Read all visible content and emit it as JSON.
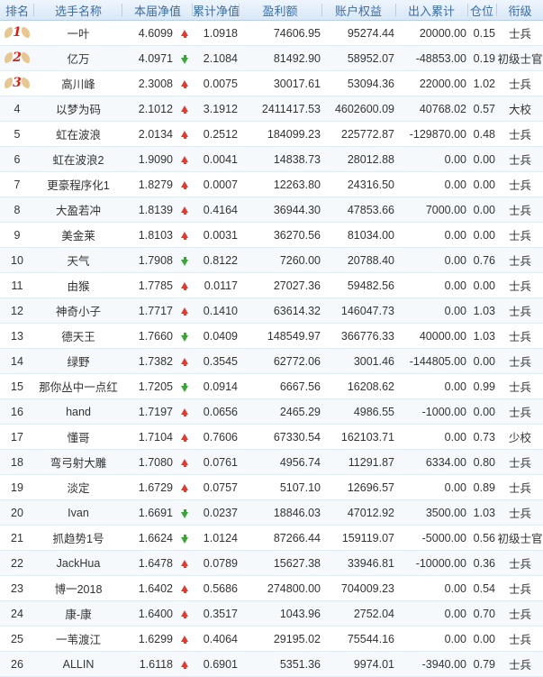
{
  "columns": {
    "rank": "排名",
    "name": "选手名称",
    "nav": "本届净值",
    "cum_nav": "累计净值",
    "profit": "盈利额",
    "equity": "账户权益",
    "flow": "出入累计",
    "position": "仓位",
    "title": "衔级"
  },
  "colors": {
    "up": "#e23b2e",
    "down": "#3aa33a",
    "header_text": "#3a6ea5",
    "medal": "#d2231b"
  },
  "rows": [
    {
      "rank": "1",
      "medal": true,
      "name": "一叶",
      "nav": "4.6099",
      "trend": "up",
      "cum_nav": "1.0918",
      "profit": "74606.95",
      "equity": "95274.44",
      "flow": "20000.00",
      "position": "0.15",
      "title": "士兵"
    },
    {
      "rank": "2",
      "medal": true,
      "name": "亿万",
      "nav": "4.0971",
      "trend": "down",
      "cum_nav": "2.1084",
      "profit": "81492.90",
      "equity": "58952.07",
      "flow": "-48853.00",
      "position": "0.19",
      "title": "初级士官"
    },
    {
      "rank": "3",
      "medal": true,
      "name": "高川峰",
      "nav": "2.3008",
      "trend": "up",
      "cum_nav": "0.0075",
      "profit": "30017.61",
      "equity": "53094.36",
      "flow": "22000.00",
      "position": "1.02",
      "title": "士兵"
    },
    {
      "rank": "4",
      "name": "以梦为码",
      "nav": "2.1012",
      "trend": "up",
      "cum_nav": "3.1912",
      "profit": "2411417.53",
      "equity": "4602600.09",
      "flow": "40768.02",
      "position": "0.57",
      "title": "大校"
    },
    {
      "rank": "5",
      "name": "虹在波浪",
      "nav": "2.0134",
      "trend": "up",
      "cum_nav": "0.2512",
      "profit": "184099.23",
      "equity": "225772.87",
      "flow": "-129870.00",
      "position": "0.48",
      "title": "士兵"
    },
    {
      "rank": "6",
      "name": "虹在波浪2",
      "nav": "1.9090",
      "trend": "up",
      "cum_nav": "0.0041",
      "profit": "14838.73",
      "equity": "28012.88",
      "flow": "0.00",
      "position": "0.00",
      "title": "士兵"
    },
    {
      "rank": "7",
      "name": "更豪程序化1",
      "nav": "1.8279",
      "trend": "up",
      "cum_nav": "0.0007",
      "profit": "12263.80",
      "equity": "24316.50",
      "flow": "0.00",
      "position": "0.00",
      "title": "士兵"
    },
    {
      "rank": "8",
      "name": "大盈若冲",
      "nav": "1.8139",
      "trend": "up",
      "cum_nav": "0.4164",
      "profit": "36944.30",
      "equity": "47853.66",
      "flow": "7000.00",
      "position": "0.00",
      "title": "士兵"
    },
    {
      "rank": "9",
      "name": "美金莱",
      "nav": "1.8103",
      "trend": "up",
      "cum_nav": "0.0031",
      "profit": "36270.56",
      "equity": "81034.00",
      "flow": "0.00",
      "position": "0.00",
      "title": "士兵"
    },
    {
      "rank": "10",
      "name": "天气",
      "nav": "1.7908",
      "trend": "down",
      "cum_nav": "0.8122",
      "profit": "7260.00",
      "equity": "20788.40",
      "flow": "0.00",
      "position": "0.76",
      "title": "士兵"
    },
    {
      "rank": "11",
      "name": "由猴",
      "nav": "1.7785",
      "trend": "up",
      "cum_nav": "0.0117",
      "profit": "27027.36",
      "equity": "59482.56",
      "flow": "0.00",
      "position": "0.00",
      "title": "士兵"
    },
    {
      "rank": "12",
      "name": "神奇小子",
      "nav": "1.7717",
      "trend": "up",
      "cum_nav": "0.1410",
      "profit": "63614.32",
      "equity": "146047.73",
      "flow": "0.00",
      "position": "1.03",
      "title": "士兵"
    },
    {
      "rank": "13",
      "name": "德天王",
      "nav": "1.7660",
      "trend": "down",
      "cum_nav": "0.0409",
      "profit": "148549.97",
      "equity": "366776.33",
      "flow": "40000.00",
      "position": "1.03",
      "title": "士兵"
    },
    {
      "rank": "14",
      "name": "绿野",
      "nav": "1.7382",
      "trend": "up",
      "cum_nav": "0.3545",
      "profit": "62772.06",
      "equity": "3001.46",
      "flow": "-144805.00",
      "position": "0.00",
      "title": "士兵"
    },
    {
      "rank": "15",
      "name": "那你丛中一点红",
      "nav": "1.7205",
      "trend": "down",
      "cum_nav": "0.0914",
      "profit": "6667.56",
      "equity": "16208.62",
      "flow": "0.00",
      "position": "0.99",
      "title": "士兵"
    },
    {
      "rank": "16",
      "name": "hand",
      "nav": "1.7197",
      "trend": "up",
      "cum_nav": "0.0656",
      "profit": "2465.29",
      "equity": "4986.55",
      "flow": "-1000.00",
      "position": "0.00",
      "title": "士兵"
    },
    {
      "rank": "17",
      "name": "懂哥",
      "nav": "1.7104",
      "trend": "up",
      "cum_nav": "0.7606",
      "profit": "67330.54",
      "equity": "162103.71",
      "flow": "0.00",
      "position": "0.73",
      "title": "少校"
    },
    {
      "rank": "18",
      "name": "弯弓射大雕",
      "nav": "1.7080",
      "trend": "up",
      "cum_nav": "0.0761",
      "profit": "4956.74",
      "equity": "11291.87",
      "flow": "6334.00",
      "position": "0.80",
      "title": "士兵"
    },
    {
      "rank": "19",
      "name": "淡定",
      "nav": "1.6729",
      "trend": "up",
      "cum_nav": "0.0757",
      "profit": "5107.10",
      "equity": "12696.57",
      "flow": "0.00",
      "position": "0.89",
      "title": "士兵"
    },
    {
      "rank": "20",
      "name": "Ivan",
      "nav": "1.6691",
      "trend": "down",
      "cum_nav": "0.0237",
      "profit": "18846.03",
      "equity": "47012.92",
      "flow": "3500.00",
      "position": "1.03",
      "title": "士兵"
    },
    {
      "rank": "21",
      "name": "抓趋势1号",
      "nav": "1.6624",
      "trend": "down",
      "cum_nav": "1.0124",
      "profit": "87266.44",
      "equity": "159119.07",
      "flow": "-5000.00",
      "position": "0.56",
      "title": "初级士官"
    },
    {
      "rank": "22",
      "name": "JackHua",
      "nav": "1.6478",
      "trend": "up",
      "cum_nav": "0.0789",
      "profit": "15627.38",
      "equity": "33946.81",
      "flow": "-10000.00",
      "position": "0.36",
      "title": "士兵"
    },
    {
      "rank": "23",
      "name": "博一2018",
      "nav": "1.6402",
      "trend": "up",
      "cum_nav": "0.5686",
      "profit": "274800.00",
      "equity": "704009.23",
      "flow": "0.00",
      "position": "0.54",
      "title": "士兵"
    },
    {
      "rank": "24",
      "name": "康-康",
      "nav": "1.6400",
      "trend": "up",
      "cum_nav": "0.3517",
      "profit": "1043.96",
      "equity": "2752.04",
      "flow": "0.00",
      "position": "0.70",
      "title": "士兵"
    },
    {
      "rank": "25",
      "name": "一苇渡江",
      "nav": "1.6299",
      "trend": "up",
      "cum_nav": "0.4064",
      "profit": "29195.02",
      "equity": "75544.16",
      "flow": "0.00",
      "position": "0.00",
      "title": "士兵"
    },
    {
      "rank": "26",
      "name": "ALLIN",
      "nav": "1.6118",
      "trend": "up",
      "cum_nav": "0.6901",
      "profit": "5351.36",
      "equity": "9974.01",
      "flow": "-3940.00",
      "position": "0.79",
      "title": "士兵"
    }
  ]
}
